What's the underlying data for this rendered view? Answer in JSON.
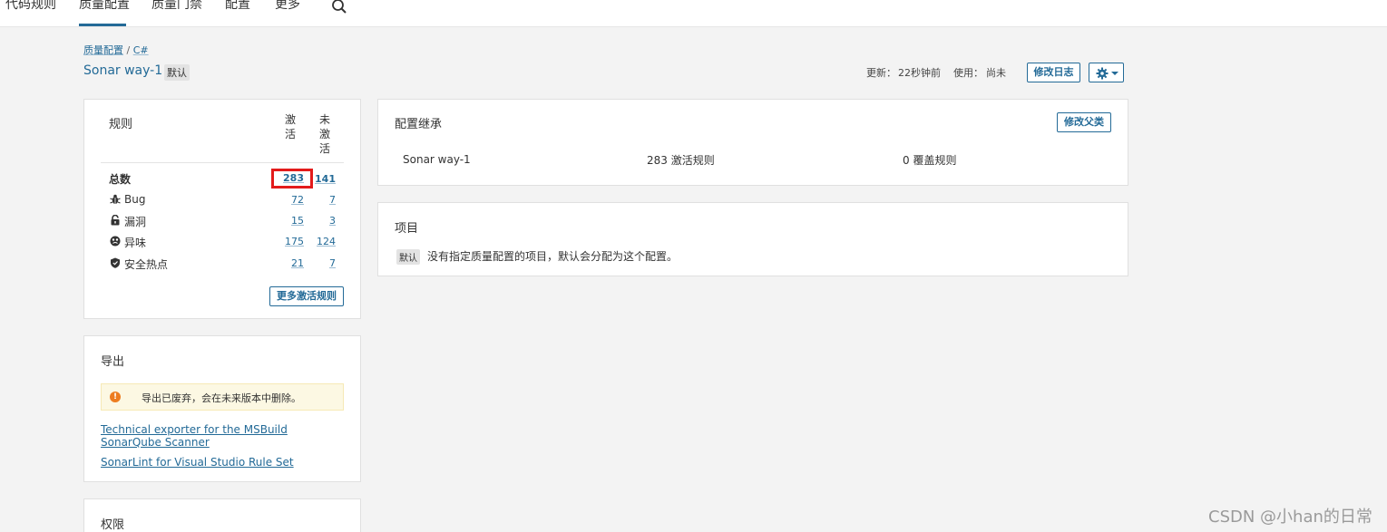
{
  "nav": {
    "items": [
      "代码规则",
      "质量配置",
      "质量门禁",
      "配置",
      "更多"
    ],
    "active": "质量配置"
  },
  "breadcrumb": {
    "parent": "质量配置",
    "separator": "/",
    "current": "C#"
  },
  "profile": {
    "name": "Sonar way-1",
    "default_badge": "默认",
    "updated_label": "更新：",
    "updated_value": "22秒钟前",
    "used_label": "使用：",
    "used_value": "尚未",
    "changelog_button": "修改日志"
  },
  "rules": {
    "title": "规则",
    "col_active": "激活",
    "col_inactive": "未激活",
    "rows": [
      {
        "label": "总数",
        "icon": "",
        "active": "283",
        "inactive": "141"
      },
      {
        "label": "Bug",
        "icon": "bug-icon",
        "active": "72",
        "inactive": "7"
      },
      {
        "label": "漏洞",
        "icon": "lock-icon",
        "active": "15",
        "inactive": "3"
      },
      {
        "label": "异味",
        "icon": "code-smell-icon",
        "active": "175",
        "inactive": "124"
      },
      {
        "label": "安全热点",
        "icon": "shield-icon",
        "active": "21",
        "inactive": "7"
      }
    ],
    "more_button": "更多激活规则"
  },
  "export": {
    "title": "导出",
    "warning": "导出已废弃，会在未来版本中删除。",
    "links": [
      "Technical exporter for the MSBuild SonarQube Scanner",
      "SonarLint for Visual Studio Rule Set"
    ]
  },
  "permissions": {
    "title": "权限"
  },
  "inheritance": {
    "title": "配置继承",
    "change_parent_button": "修改父类",
    "profile_name": "Sonar way-1",
    "active_rules": "283 激活规则",
    "overridden_rules": "0 覆盖规则"
  },
  "projects": {
    "title": "项目",
    "badge": "默认",
    "text": "没有指定质量配置的项目，默认会分配为这个配置。"
  },
  "watermark": "CSDN @小han的日常",
  "colors": {
    "link": "#236a97",
    "highlight": "#e31b1b",
    "warning": "#ed7d20"
  }
}
